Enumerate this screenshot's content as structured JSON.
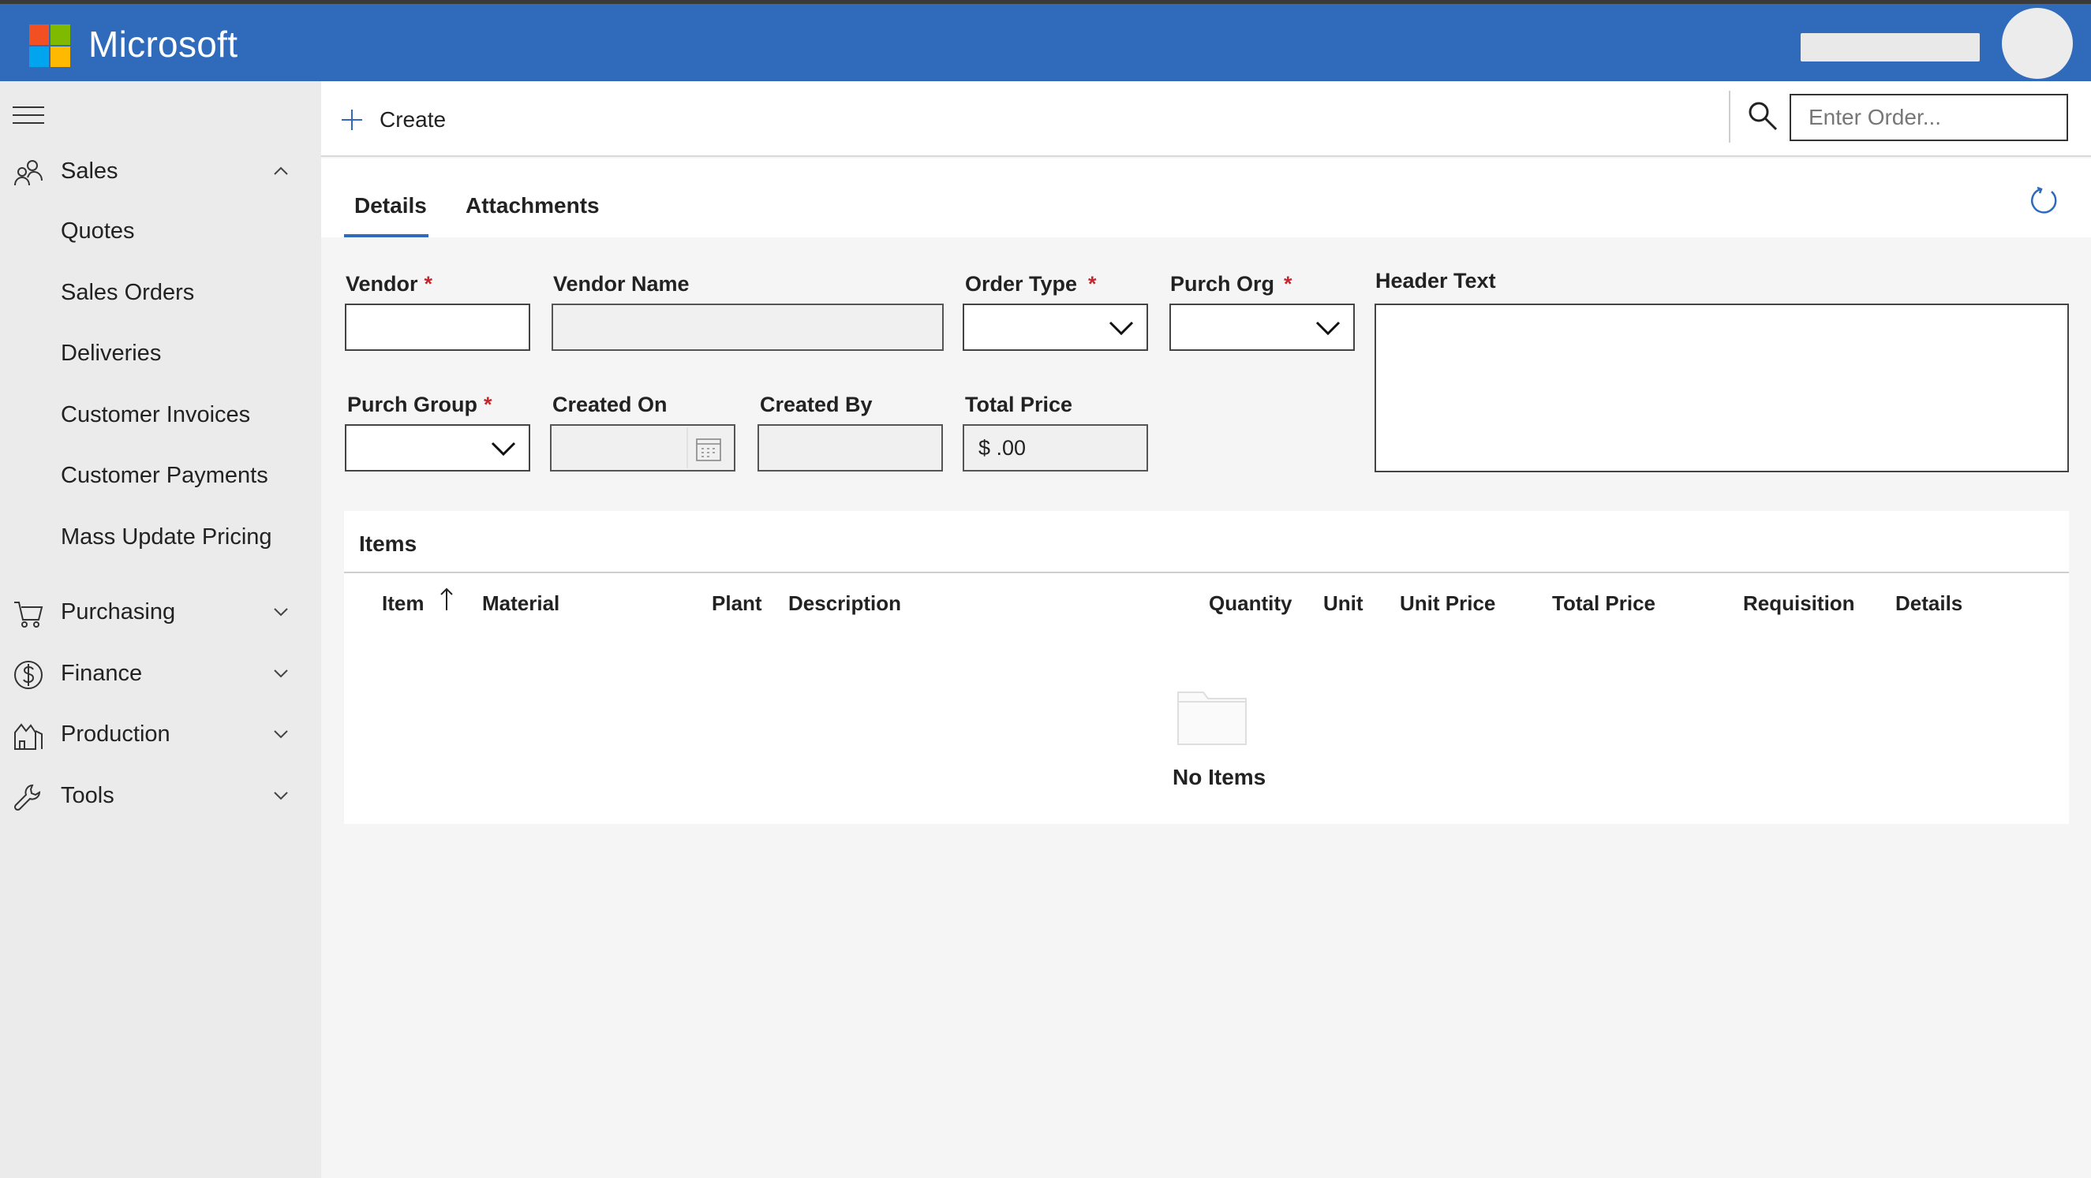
{
  "header": {
    "brand": "Microsoft",
    "colors": {
      "bar": "#2f6bba",
      "logo_red": "#f25022",
      "logo_green": "#7fba00",
      "logo_blue": "#00a4ef",
      "logo_yellow": "#ffb900"
    }
  },
  "sidebar": {
    "menu_icon": "hamburger-icon",
    "groups": [
      {
        "label": "Sales",
        "icon": "people-icon",
        "expanded": true,
        "items": [
          "Quotes",
          "Sales Orders",
          "Deliveries",
          "Customer Invoices",
          "Customer Payments",
          "Mass Update Pricing"
        ]
      },
      {
        "label": "Purchasing",
        "icon": "cart-icon",
        "expanded": false
      },
      {
        "label": "Finance",
        "icon": "dollar-circle-icon",
        "expanded": false
      },
      {
        "label": "Production",
        "icon": "factory-icon",
        "expanded": false
      },
      {
        "label": "Tools",
        "icon": "wrench-icon",
        "expanded": false
      }
    ]
  },
  "commandbar": {
    "create_label": "Create",
    "search_placeholder": "Enter Order..."
  },
  "tabs": [
    {
      "label": "Details",
      "active": true
    },
    {
      "label": "Attachments",
      "active": false
    }
  ],
  "form": {
    "vendor": {
      "label": "Vendor",
      "required": "*",
      "value": ""
    },
    "vendor_name": {
      "label": "Vendor Name",
      "value": ""
    },
    "order_type": {
      "label": "Order Type",
      "required": "*",
      "value": ""
    },
    "purch_org": {
      "label": "Purch Org",
      "required": "*",
      "value": ""
    },
    "header_text": {
      "label": "Header Text",
      "value": ""
    },
    "purch_group": {
      "label": "Purch Group",
      "required": "*",
      "value": ""
    },
    "created_on": {
      "label": "Created On",
      "value": ""
    },
    "created_by": {
      "label": "Created By",
      "value": ""
    },
    "total_price": {
      "label": "Total Price",
      "value": "$ .00"
    }
  },
  "items": {
    "title": "Items",
    "columns": [
      "Item",
      "Material",
      "Plant",
      "Description",
      "Quantity",
      "Unit",
      "Unit Price",
      "Total Price",
      "Requisition",
      "Details"
    ],
    "sort_column": "Item",
    "sort_direction": "ascending",
    "empty_text": "No Items"
  }
}
